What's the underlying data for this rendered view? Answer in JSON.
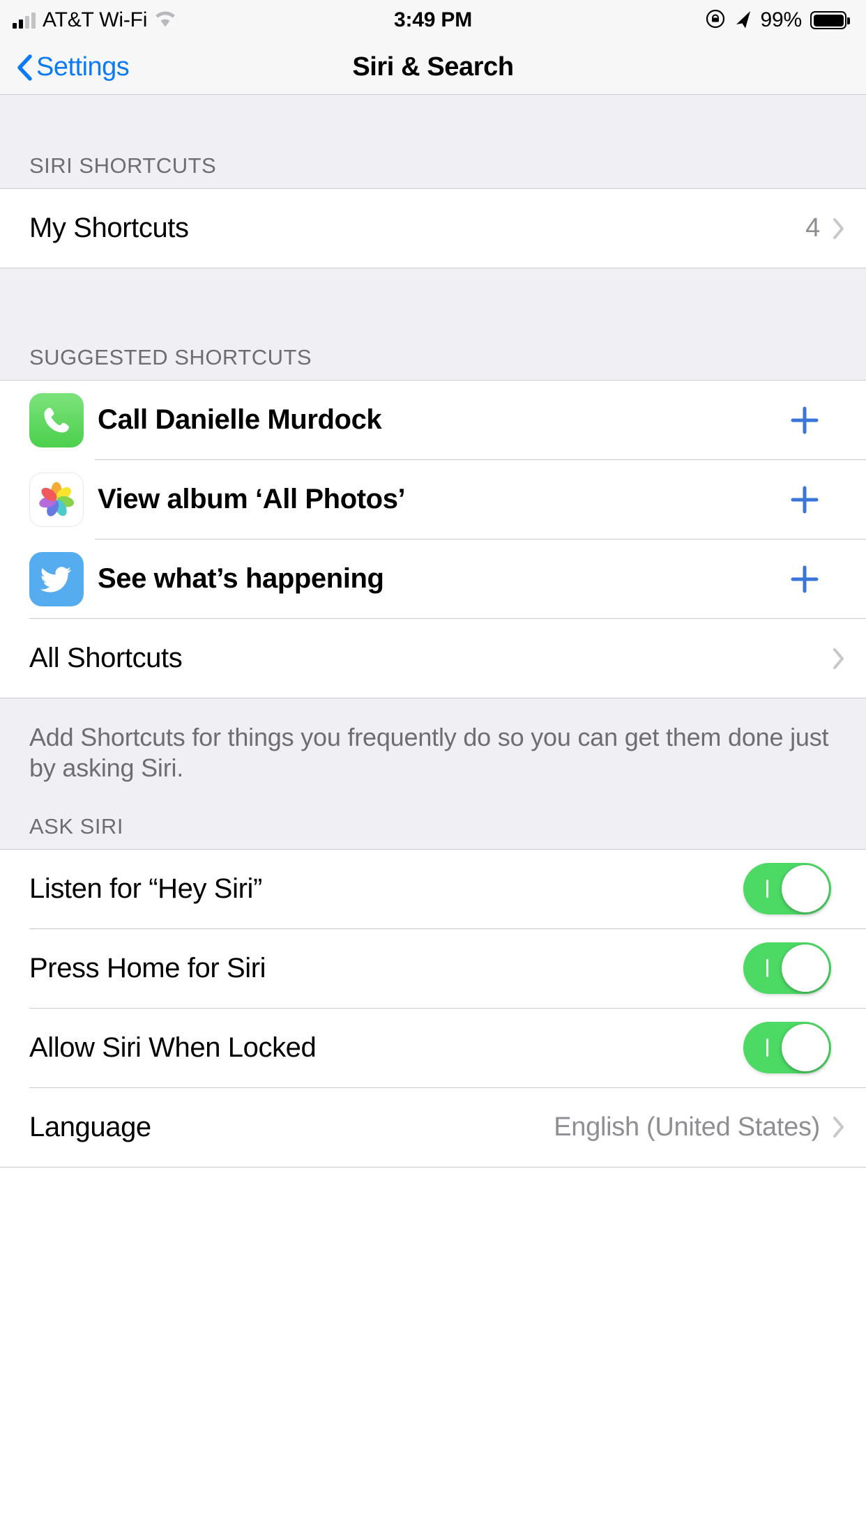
{
  "status_bar": {
    "carrier": "AT&T Wi-Fi",
    "signal_bars_filled": 2,
    "signal_bars_total": 4,
    "wifi_icon": "wifi-icon",
    "time": "3:49 PM",
    "rotation_lock_icon": "rotation-lock-icon",
    "location_icon": "location-arrow-icon",
    "battery_percent": "99%",
    "battery_level": 99
  },
  "nav": {
    "back_label": "Settings",
    "back_icon": "chevron-left-icon",
    "title": "Siri & Search"
  },
  "sections": {
    "siri_shortcuts": {
      "header": "SIRI SHORTCUTS",
      "rows": [
        {
          "title": "My Shortcuts",
          "value": "4",
          "accessory": "chevron-right-icon"
        }
      ]
    },
    "suggested_shortcuts": {
      "header": "SUGGESTED SHORTCUTS",
      "rows": [
        {
          "title": "Call Danielle Murdock",
          "icon": "phone-app-icon",
          "accessory": "plus-icon"
        },
        {
          "title": "View album ‘All Photos’",
          "icon": "photos-app-icon",
          "accessory": "plus-icon"
        },
        {
          "title": "See what’s happening",
          "icon": "twitter-app-icon",
          "accessory": "plus-icon"
        }
      ],
      "all_shortcuts": {
        "title": "All Shortcuts",
        "accessory": "chevron-right-icon"
      },
      "footer": "Add Shortcuts for things you frequently do so you can get them done just by asking Siri."
    },
    "ask_siri": {
      "header": "ASK SIRI",
      "rows": [
        {
          "title": "Listen for “Hey Siri”",
          "toggle": "on"
        },
        {
          "title": "Press Home for Siri",
          "toggle": "on"
        },
        {
          "title": "Allow Siri When Locked",
          "toggle": "on"
        },
        {
          "title": "Language",
          "value": "English (United States)",
          "accessory": "chevron-right-icon"
        }
      ]
    }
  },
  "colors": {
    "accent_blue": "#0a7bf5",
    "toggle_on_green": "#4cd964",
    "group_background": "#efeff4",
    "cell_background": "#ffffff",
    "separator": "#c9c9ce",
    "secondary_text": "#8e8e93",
    "header_text": "#6d6d72",
    "phone_icon_green": "#4cd04c",
    "twitter_blue": "#55acee"
  }
}
